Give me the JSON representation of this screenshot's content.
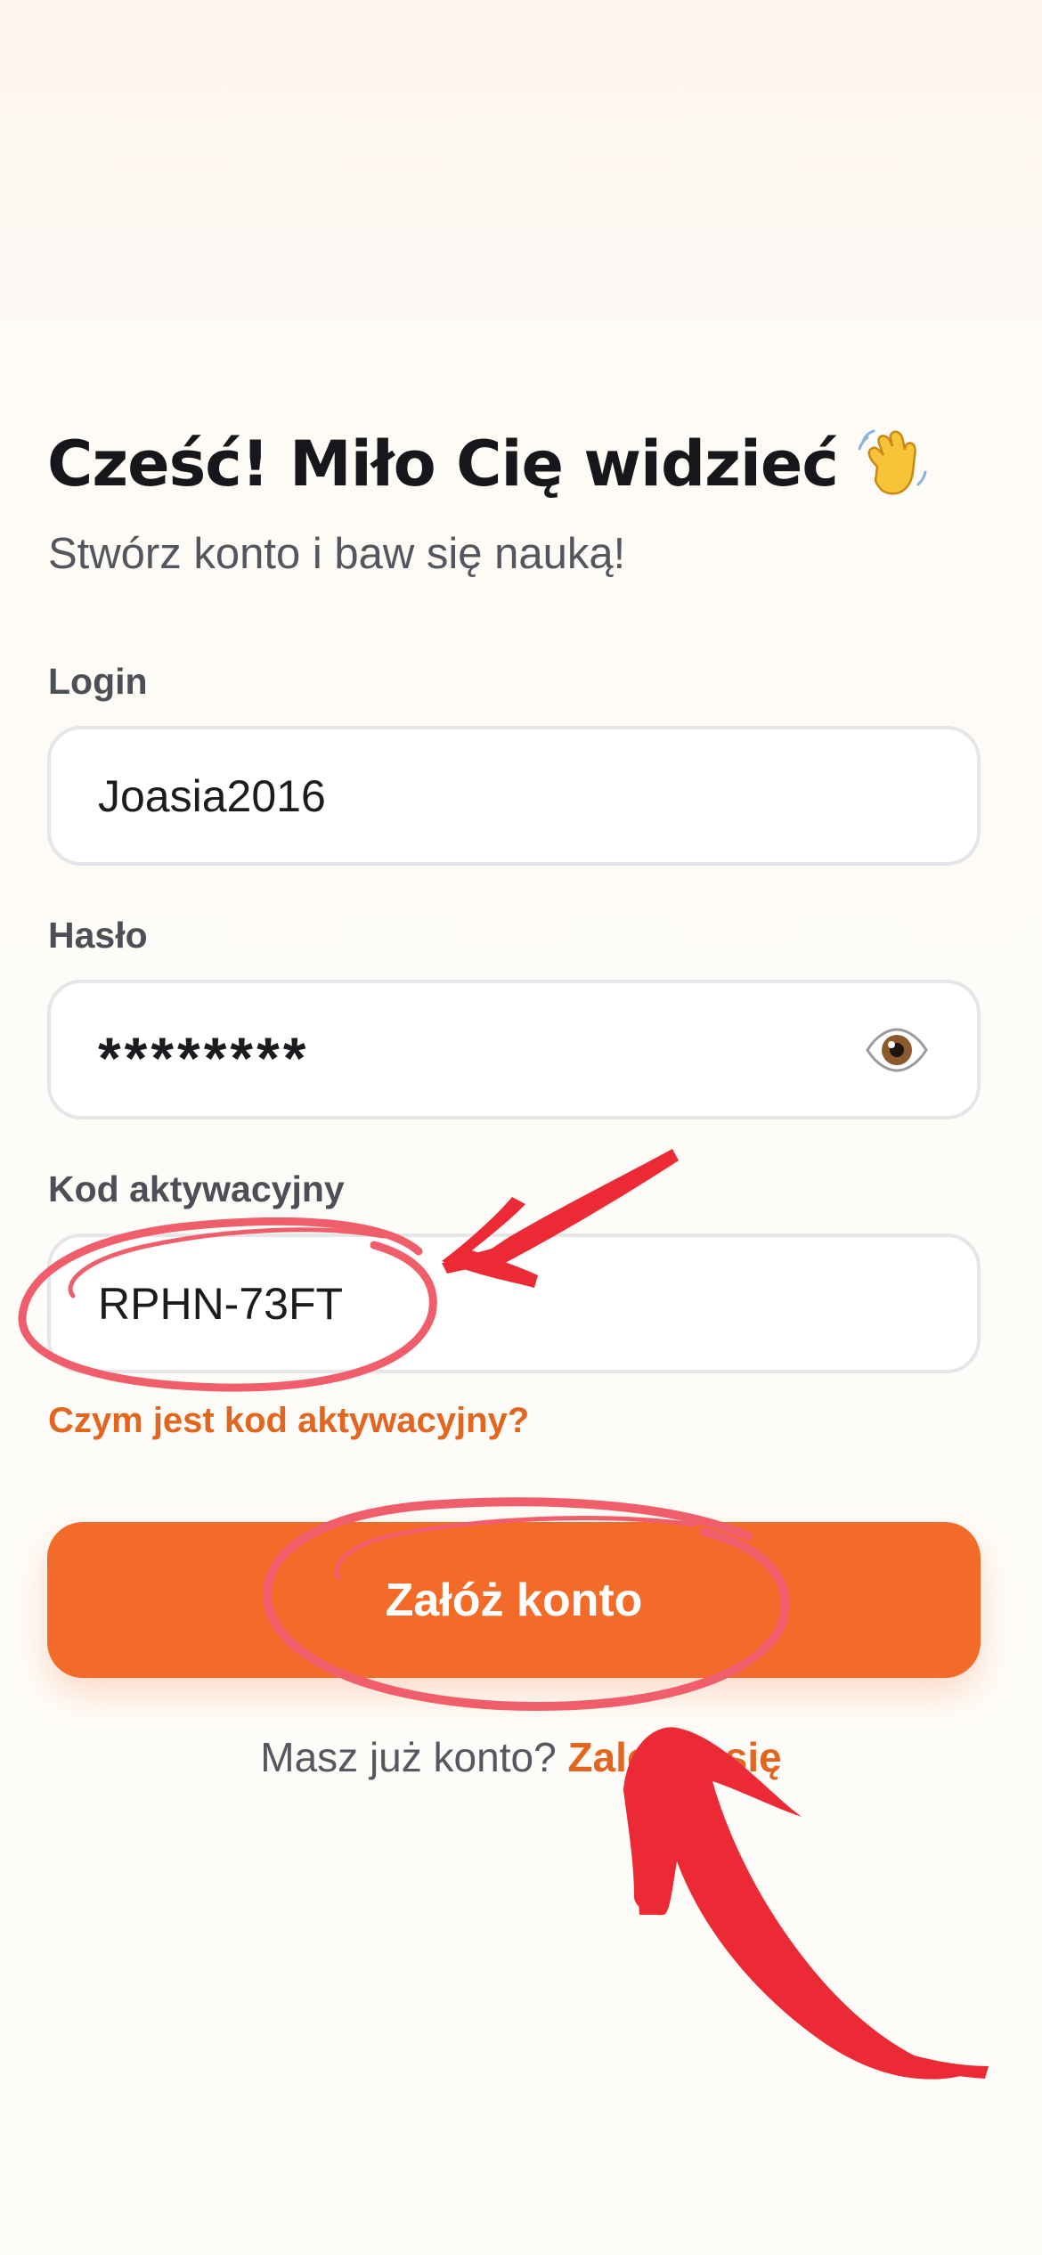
{
  "header": {
    "title": "Cześć! Miło Cię widzieć",
    "title_icon": "waving-hand-icon",
    "subtitle": "Stwórz konto i baw się nauką!"
  },
  "form": {
    "login": {
      "label": "Login",
      "value": "Joasia2016"
    },
    "password": {
      "label": "Hasło",
      "value": "********",
      "toggle_icon": "eye-icon"
    },
    "activation_code": {
      "label": "Kod aktywacyjny",
      "value": "RPHN-73FT",
      "help_link": "Czym jest kod aktywacyjny?"
    },
    "submit_label": "Załóż konto"
  },
  "footer": {
    "prompt": "Masz już konto?",
    "login_link": "Zaloguj się"
  },
  "colors": {
    "accent": "#f26b28",
    "link": "#e2661f",
    "annotation": "#ec2a36",
    "annotation_ring": "#f05e6c"
  }
}
